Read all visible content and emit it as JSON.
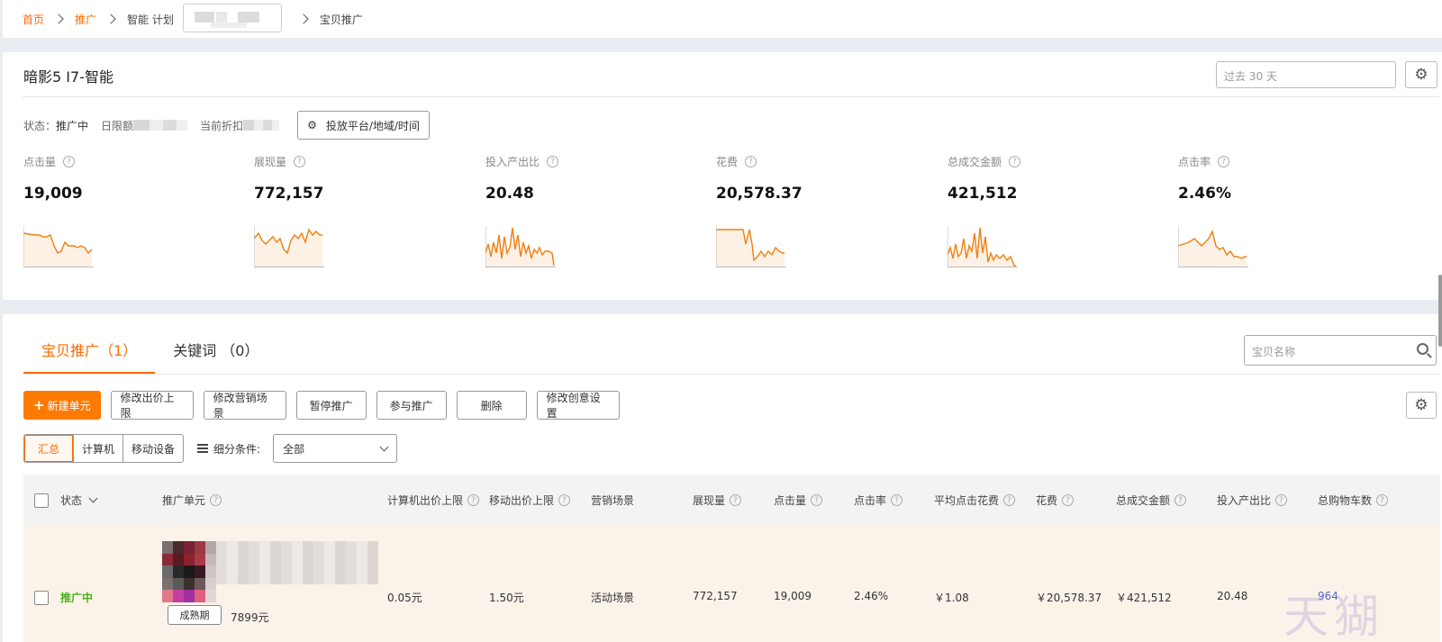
{
  "breadcrumb": {
    "home": "首页",
    "promo": "推广",
    "plan": "智能 计划",
    "current": "宝贝推广"
  },
  "summary": {
    "title": "暗影5 I7-智能",
    "date_range": "过去 30 天",
    "status_label": "状态：",
    "status_value": "推广中",
    "daily_limit_label": "日限额",
    "discount_label": "当前折扣",
    "platform_button": "投放平台/地域/时间"
  },
  "kpis": [
    {
      "label": "点击量",
      "value": "19,009"
    },
    {
      "label": "展现量",
      "value": "772,157"
    },
    {
      "label": "投入产出比",
      "value": "20.48"
    },
    {
      "label": "花费",
      "value": "20,578.37"
    },
    {
      "label": "总成交金额",
      "value": "421,512"
    },
    {
      "label": "点击率",
      "value": "2.46%"
    }
  ],
  "tabs": [
    {
      "label": "宝贝推广（1）"
    },
    {
      "label": "关键词 （0）"
    }
  ],
  "search_placeholder": "宝贝名称",
  "toolbar": {
    "new_unit": "新建单元",
    "edit_bid_cap": "修改出价上限",
    "edit_scene": "修改营销场景",
    "pause": "暂停推广",
    "join": "参与推广",
    "delete": "删除",
    "edit_creative": "修改创意设置"
  },
  "filters": {
    "segments": [
      "汇总",
      "计算机",
      "移动设备"
    ],
    "detail_label": "细分条件:",
    "select_value": "全部"
  },
  "table": {
    "headers": {
      "status": "状态",
      "unit": "推广单元",
      "pc_bid": "计算机出价上限",
      "mobile_bid": "移动出价上限",
      "scene": "营销场景",
      "impressions": "展现量",
      "clicks": "点击量",
      "ctr": "点击率",
      "cpc": "平均点击花费",
      "cost": "花费",
      "gmv": "总成交金额",
      "roi": "投入产出比",
      "cart": "总购物车数"
    },
    "row": {
      "status": "推广中",
      "stage": "成熟期",
      "price": "7899元",
      "pc_bid": "0.05元",
      "mobile_bid": "1.50元",
      "scene": "活动场景",
      "impressions": "772,157",
      "clicks": "19,009",
      "ctr": "2.46%",
      "cpc": "￥1.08",
      "cost": "￥20,578.37",
      "gmv": "￥421,512",
      "roi": "20.48",
      "cart": "964"
    }
  },
  "watermark": "天猢",
  "colors": {
    "accent": "#ff6a00",
    "spark": "#f08010",
    "status_green": "#4caf1a"
  }
}
